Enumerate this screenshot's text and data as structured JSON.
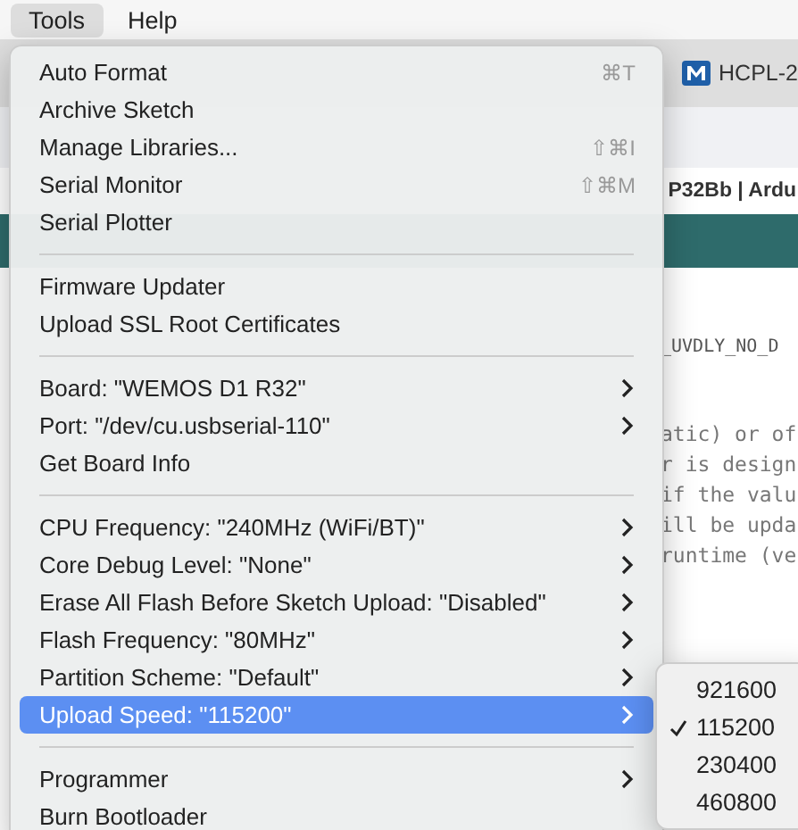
{
  "menubar": [
    {
      "label": "Tools",
      "selected": true
    },
    {
      "label": "Help",
      "selected": false
    }
  ],
  "background": {
    "tab": "HCPL-2",
    "title": "P32Bb | Ardu",
    "header_line": "_UVDLY_NO_D",
    "code_lines": [
      "atic) or of",
      "r is design",
      "if the valu",
      "ill be upda",
      "runtime (ve"
    ]
  },
  "menu": {
    "items": [
      {
        "kind": "item",
        "label": "Auto Format",
        "shortcut": "⌘T",
        "submenu": false,
        "selected": false
      },
      {
        "kind": "item",
        "label": "Archive Sketch",
        "submenu": false,
        "selected": false
      },
      {
        "kind": "item",
        "label": "Manage Libraries...",
        "shortcut": "⇧⌘I",
        "submenu": false,
        "selected": false
      },
      {
        "kind": "item",
        "label": "Serial Monitor",
        "shortcut": "⇧⌘M",
        "submenu": false,
        "selected": false
      },
      {
        "kind": "item",
        "label": "Serial Plotter",
        "submenu": false,
        "selected": false
      },
      {
        "kind": "separator"
      },
      {
        "kind": "item",
        "label": "Firmware Updater",
        "submenu": false,
        "selected": false
      },
      {
        "kind": "item",
        "label": "Upload SSL Root Certificates",
        "submenu": false,
        "selected": false
      },
      {
        "kind": "separator"
      },
      {
        "kind": "item",
        "label": "Board: \"WEMOS D1 R32\"",
        "submenu": true,
        "selected": false
      },
      {
        "kind": "item",
        "label": "Port: \"/dev/cu.usbserial-110\"",
        "submenu": true,
        "selected": false
      },
      {
        "kind": "item",
        "label": "Get Board Info",
        "submenu": false,
        "selected": false
      },
      {
        "kind": "separator"
      },
      {
        "kind": "item",
        "label": "CPU Frequency: \"240MHz (WiFi/BT)\"",
        "submenu": true,
        "selected": false
      },
      {
        "kind": "item",
        "label": "Core Debug Level: \"None\"",
        "submenu": true,
        "selected": false
      },
      {
        "kind": "item",
        "label": "Erase All Flash Before Sketch Upload: \"Disabled\"",
        "submenu": true,
        "selected": false
      },
      {
        "kind": "item",
        "label": "Flash Frequency: \"80MHz\"",
        "submenu": true,
        "selected": false
      },
      {
        "kind": "item",
        "label": "Partition Scheme: \"Default\"",
        "submenu": true,
        "selected": false
      },
      {
        "kind": "item",
        "label": "Upload Speed: \"115200\"",
        "submenu": true,
        "selected": true
      },
      {
        "kind": "separator"
      },
      {
        "kind": "item",
        "label": "Programmer",
        "submenu": true,
        "selected": false
      },
      {
        "kind": "item",
        "label": "Burn Bootloader",
        "submenu": false,
        "selected": false
      }
    ]
  },
  "submenu": {
    "items": [
      {
        "label": "921600",
        "checked": false
      },
      {
        "label": "115200",
        "checked": true
      },
      {
        "label": "230400",
        "checked": false
      },
      {
        "label": "460800",
        "checked": false
      }
    ]
  }
}
